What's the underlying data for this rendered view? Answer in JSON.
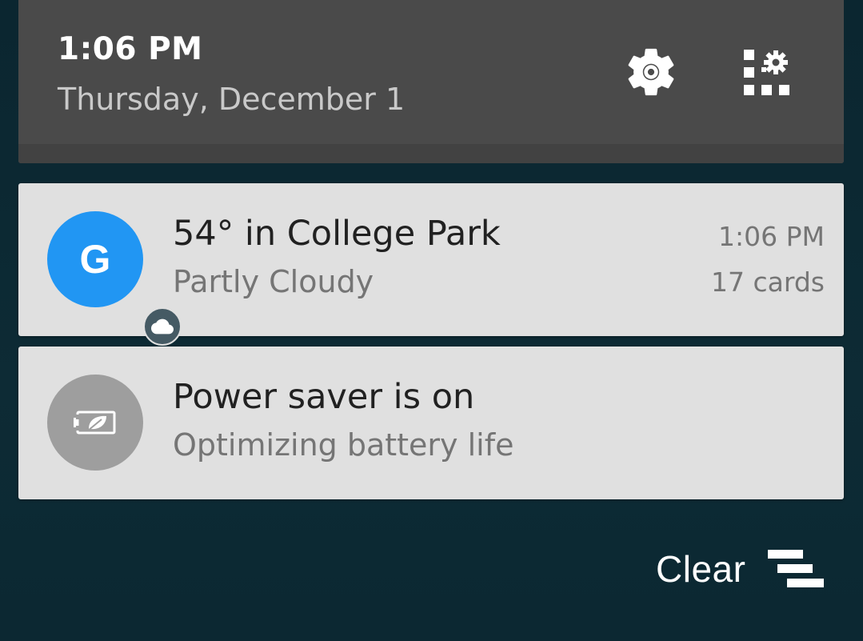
{
  "quick_settings": {
    "time": "1:06 PM",
    "date": "Thursday, December 1",
    "settings_icon": "gear-icon",
    "edit_tiles_icon": "edit-tiles-icon"
  },
  "notifications": [
    {
      "app_icon": "google-icon",
      "app_letter": "G",
      "badge_icon": "cloud-icon",
      "title": "54° in College Park",
      "text": "Partly Cloudy",
      "time": "1:06 PM",
      "info": "17 cards",
      "icon_color": "#2196f3"
    },
    {
      "app_icon": "battery-saver-icon",
      "title": "Power saver is on",
      "text": "Optimizing battery life",
      "icon_color": "#9e9e9e"
    }
  ],
  "clear_all": {
    "label": "Clear",
    "icon": "clear-all-icon"
  }
}
